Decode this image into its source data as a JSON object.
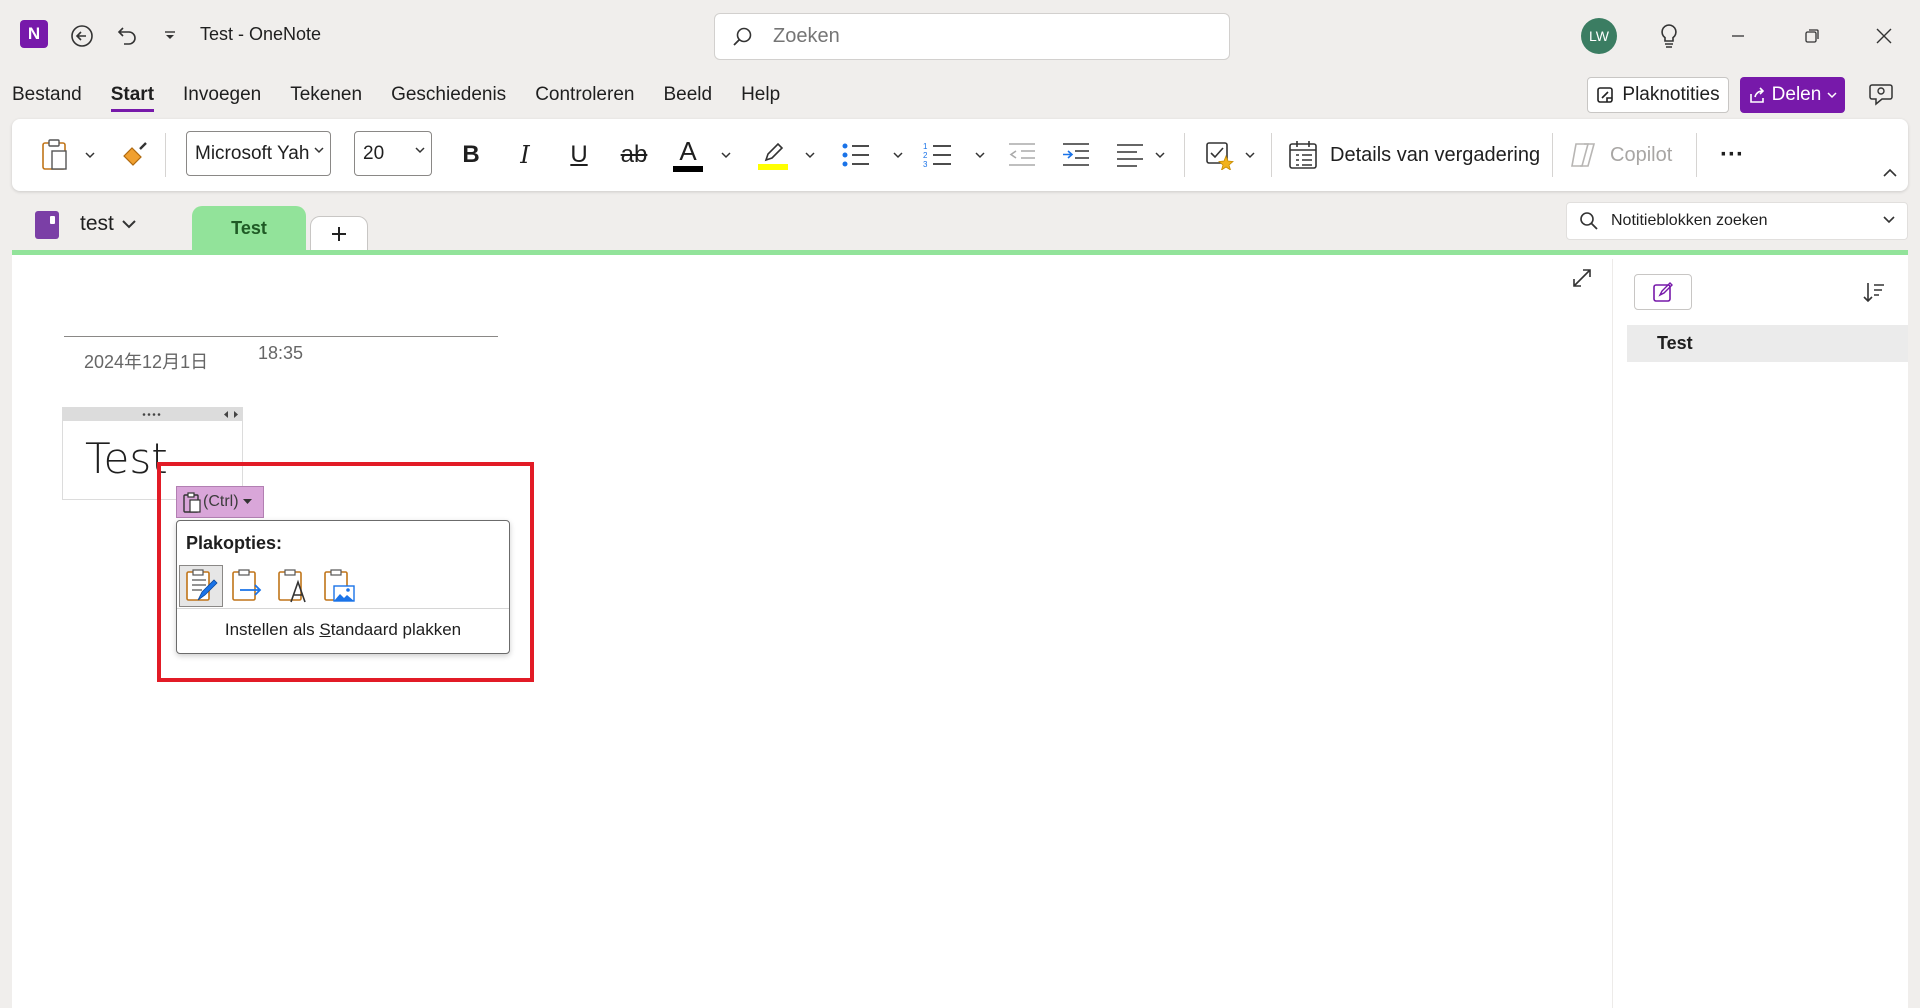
{
  "titlebar": {
    "app_icon_letter": "N",
    "title": "Test  -  OneNote",
    "search_placeholder": "Zoeken",
    "avatar_initials": "LW"
  },
  "menu": {
    "items": [
      "Bestand",
      "Start",
      "Invoegen",
      "Tekenen",
      "Geschiedenis",
      "Controleren",
      "Beeld",
      "Help"
    ],
    "active": "Start",
    "sticky_notes_label": "Plaknotities",
    "share_label": "Delen"
  },
  "ribbon": {
    "font_name": "Microsoft Yah",
    "font_size": "20",
    "bold": "B",
    "italic": "I",
    "underline": "U",
    "strike": "ab",
    "font_color_glyph": "A",
    "meeting_details_label": "Details van vergadering",
    "copilot_label": "Copilot",
    "more": "···",
    "colors": {
      "font_color": "#000000",
      "highlight": "#ffff00",
      "accent": "#7719aa"
    }
  },
  "notebook": {
    "name": "test",
    "active_section": "Test",
    "add_section": "+",
    "search_placeholder": "Notitieblokken zoeken",
    "section_color": "#92e39a"
  },
  "page": {
    "date": "2024年12月1日",
    "time": "18:35",
    "note_text": "Test"
  },
  "page_list": {
    "items": [
      "Test"
    ]
  },
  "paste_options": {
    "ctrl_label": "(Ctrl)",
    "heading": "Plakopties:",
    "options": [
      "keep-source-formatting",
      "merge-formatting",
      "keep-text-only",
      "picture"
    ],
    "set_default_prefix": "Instellen als ",
    "set_default_underlined": "S",
    "set_default_suffix": "tandaard plakken"
  }
}
